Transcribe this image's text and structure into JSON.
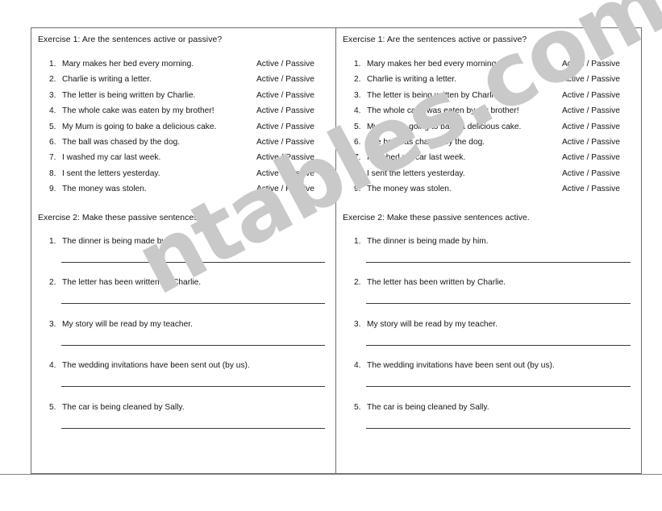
{
  "watermark": {
    "text": "ntables.com",
    "color": "#c9c9c9"
  },
  "worksheet": {
    "exercise1": {
      "heading": "Exercise 1: Are the sentences active or passive?",
      "choice_label": "Active / Passive",
      "items": [
        {
          "number": "1.",
          "sentence": "Mary makes her bed every morning.",
          "choice": "Active / Passive"
        },
        {
          "number": "2.",
          "sentence": "Charlie is writing a letter.",
          "choice": "Active / Passive"
        },
        {
          "number": "3.",
          "sentence": "The letter is being written by Charlie.",
          "choice": "Active / Passive"
        },
        {
          "number": "4.",
          "sentence": "The whole cake was eaten by my brother!",
          "choice": "Active / Passive"
        },
        {
          "number": "5.",
          "sentence": "My Mum is going to bake a delicious cake.",
          "choice": "Active / Passive"
        },
        {
          "number": "6.",
          "sentence": "The ball was chased by the dog.",
          "choice": "Active / Passive"
        },
        {
          "number": "7.",
          "sentence": "I washed my car last week.",
          "choice": "Active / Passive"
        },
        {
          "number": "8.",
          "sentence": "I sent the letters yesterday.",
          "choice": "Active / Passive"
        },
        {
          "number": "9.",
          "sentence": "The money was stolen.",
          "choice": "Active / Passive"
        }
      ]
    },
    "exercise2": {
      "heading": "Exercise 2: Make these passive sentences active.",
      "items": [
        {
          "number": "1.",
          "sentence": "The dinner is being made by him."
        },
        {
          "number": "2.",
          "sentence": "The letter has been written by Charlie."
        },
        {
          "number": "3.",
          "sentence": "My story will be read by my teacher."
        },
        {
          "number": "4.",
          "sentence": "The wedding invitations have been sent out (by us)."
        },
        {
          "number": "5.",
          "sentence": "The car is being cleaned by Sally."
        }
      ]
    }
  },
  "columns": [
    {
      "id": "left",
      "label": "left-copy"
    },
    {
      "id": "right",
      "label": "right-copy"
    }
  ]
}
